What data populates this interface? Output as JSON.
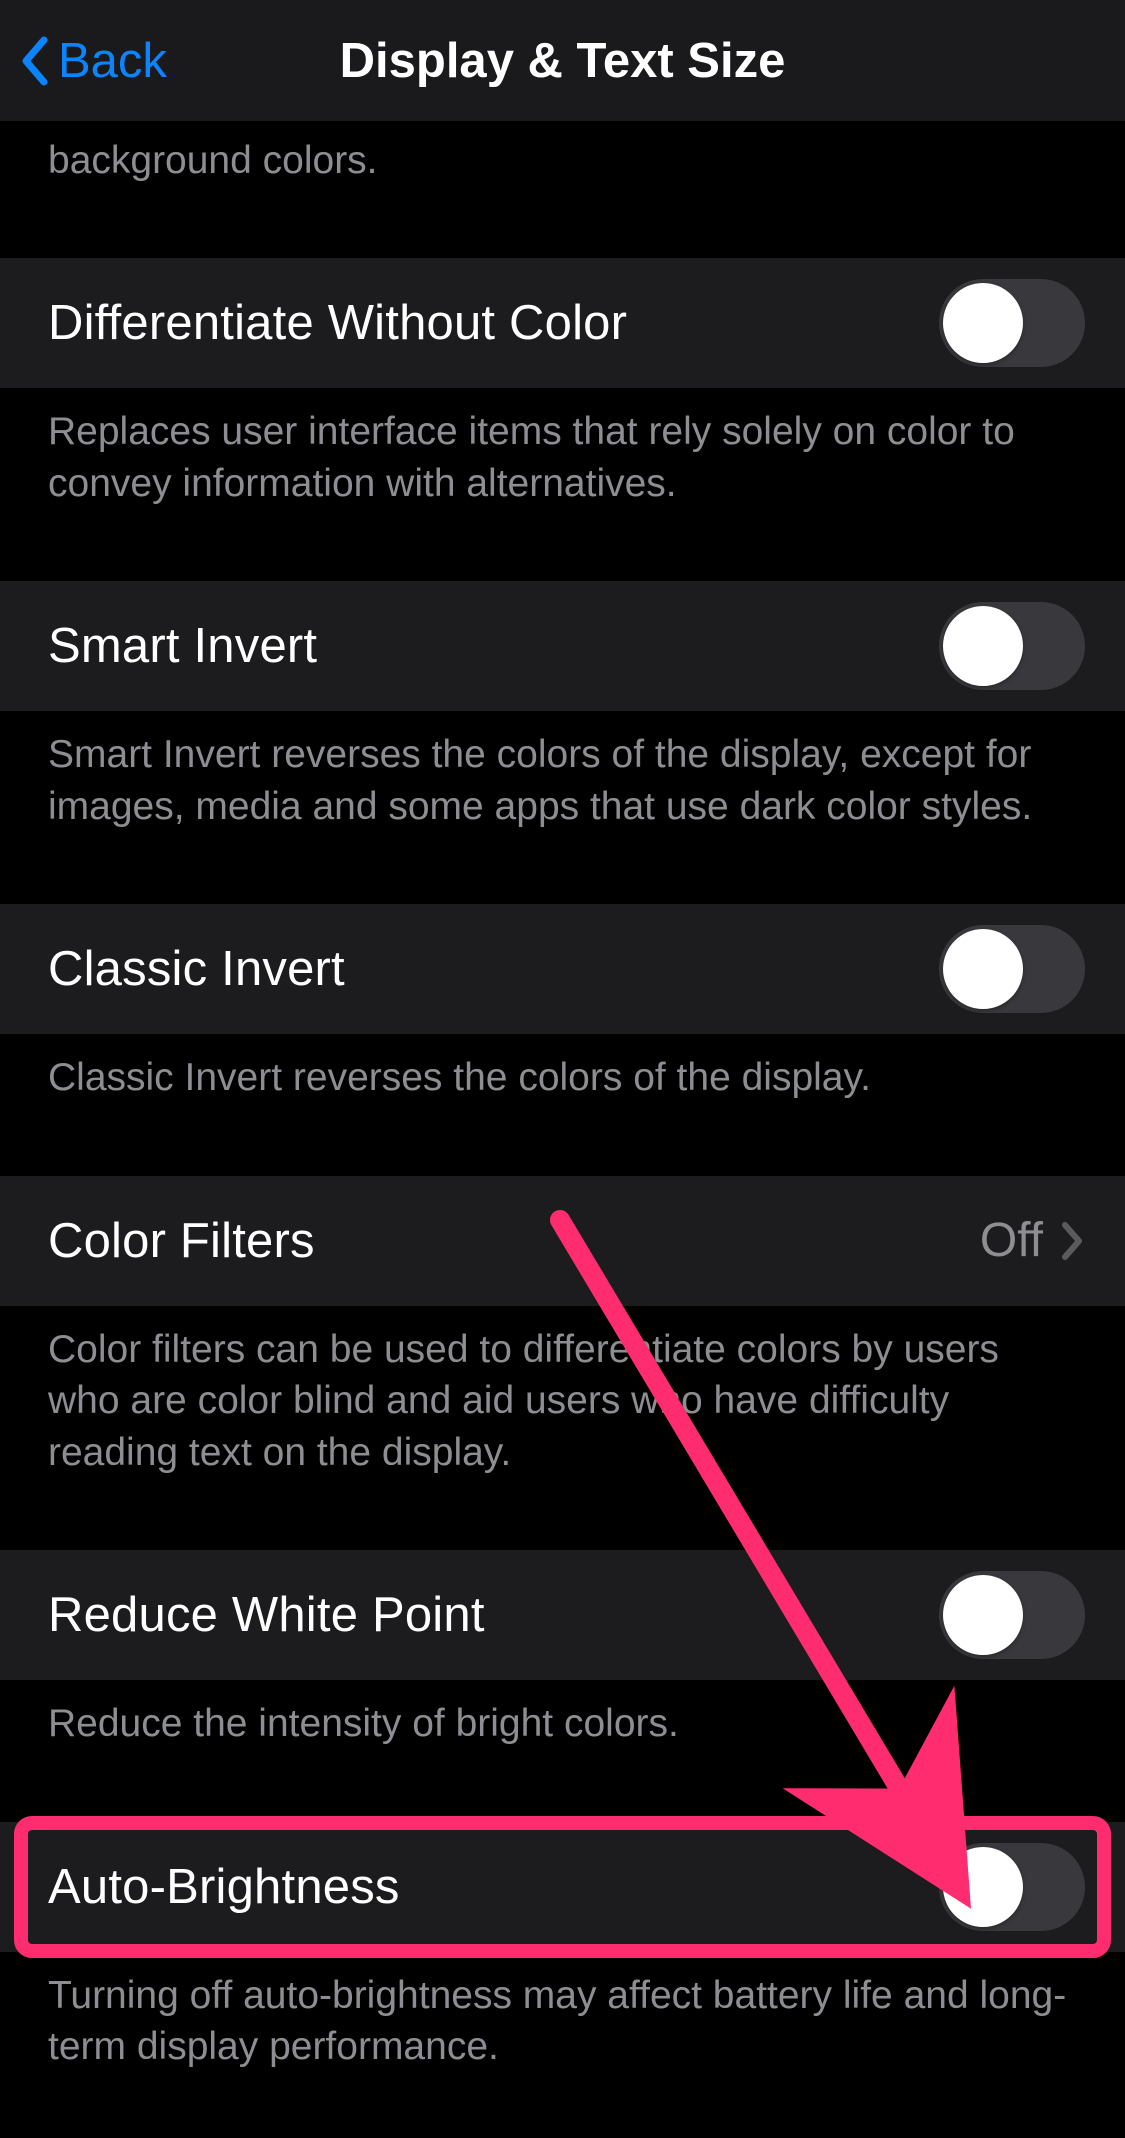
{
  "navbar": {
    "back_label": "Back",
    "title": "Display & Text Size"
  },
  "partial_first_footer": "background colors.",
  "rows": [
    {
      "key": "differentiate",
      "label": "Differentiate Without Color",
      "footer": "Replaces user interface items that rely solely on color to convey information with alternatives.",
      "toggle_on": false
    },
    {
      "key": "smart-invert",
      "label": "Smart Invert",
      "footer": "Smart Invert reverses the colors of the display, except for images, media and some apps that use dark color styles.",
      "toggle_on": false
    },
    {
      "key": "classic-invert",
      "label": "Classic Invert",
      "footer": "Classic Invert reverses the colors of the display.",
      "toggle_on": false
    },
    {
      "key": "color-filters",
      "label": "Color Filters",
      "value": "Off",
      "footer": "Color filters can be used to differentiate colors by users who are color blind and aid users who have difficulty reading text on the display.",
      "nav": true
    },
    {
      "key": "reduce-white-point",
      "label": "Reduce White Point",
      "footer": "Reduce the intensity of bright colors.",
      "toggle_on": false
    },
    {
      "key": "auto-brightness",
      "label": "Auto-Brightness",
      "footer": "Turning off auto-brightness may affect battery life and long-term display performance.",
      "toggle_on": false,
      "highlighted": true
    }
  ],
  "annotation": {
    "arrow_color": "#ff2d6f"
  }
}
